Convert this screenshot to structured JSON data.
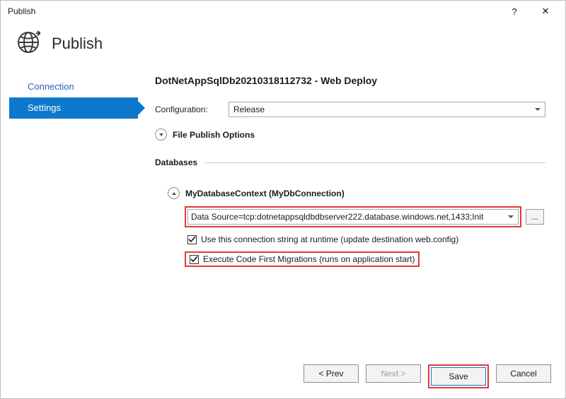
{
  "window": {
    "title": "Publish",
    "help_glyph": "?",
    "close_glyph": "✕"
  },
  "header": {
    "title": "Publish"
  },
  "sidebar": {
    "items": [
      {
        "label": "Connection",
        "selected": false
      },
      {
        "label": "Settings",
        "selected": true
      }
    ]
  },
  "main": {
    "title": "DotNetAppSqlDb20210318112732 - Web Deploy",
    "config_label": "Configuration:",
    "config_value": "Release",
    "file_publish_options_label": "File Publish Options",
    "databases_label": "Databases",
    "db_context_title": "MyDatabaseContext (MyDbConnection)",
    "conn_value": "Data Source=tcp:dotnetappsqldbdbserver222.database.windows.net,1433;Init",
    "ellipsis_label": "...",
    "use_conn_label": "Use this connection string at runtime (update destination web.config)",
    "exec_migrations_label": "Execute Code First Migrations (runs on application start)",
    "use_conn_checked": true,
    "exec_migrations_checked": true
  },
  "footer": {
    "prev_label": "< Prev",
    "next_label": "Next >",
    "save_label": "Save",
    "cancel_label": "Cancel"
  }
}
